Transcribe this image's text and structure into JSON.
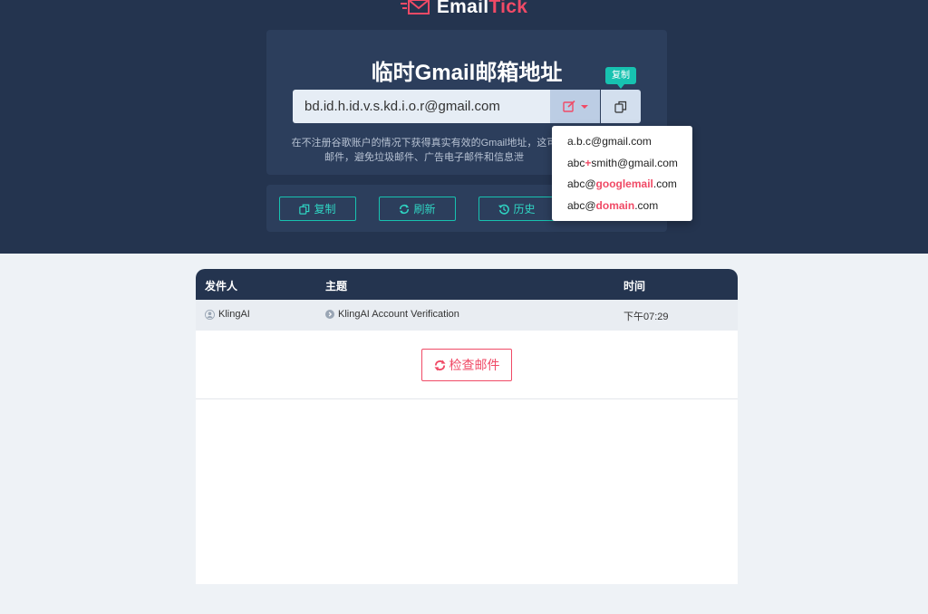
{
  "app": {
    "brand_a": "Email",
    "brand_b": "Tick"
  },
  "hero": {
    "title": "临时Gmail邮箱地址",
    "email_value": "bd.id.h.id.v.s.kd.i.o.r@gmail.com",
    "copy_tooltip": "复制",
    "description_line1": "在不注册谷歌账户的情况下获得真实有效的Gmail地址，这可",
    "description_line2": "邮件，避免垃圾邮件、广告电子邮件和信息泄"
  },
  "dropdown": {
    "items": [
      {
        "pre": "a.b.c@gmail.com",
        "hl": "",
        "post": ""
      },
      {
        "pre": "abc",
        "hl": "+",
        "post": "smith@gmail.com"
      },
      {
        "pre": "abc@",
        "hl": "googlemail",
        "post": ".com"
      },
      {
        "pre": "abc@",
        "hl": "domain",
        "post": ".com"
      }
    ]
  },
  "actions": {
    "copy": "复制",
    "refresh": "刷新",
    "history": "历史"
  },
  "table": {
    "headers": {
      "sender": "发件人",
      "subject": "主题",
      "time": "时间"
    },
    "rows": [
      {
        "sender": "KlingAI",
        "subject": "KlingAI Account Verification",
        "time": "下午07:29"
      }
    ],
    "check_button": "检查邮件"
  },
  "colors": {
    "header_bg": "#24344f",
    "card_bg": "#2c3e5c",
    "accent_teal": "#17c2b0",
    "accent_pink": "#f04a66"
  },
  "icons": {
    "logo": "envelope-icon",
    "edit": "edit-icon",
    "copy": "copy-icon",
    "refresh": "refresh-icon",
    "history": "history-icon",
    "user": "user-icon",
    "arrow": "arrow-right-circle-icon"
  }
}
